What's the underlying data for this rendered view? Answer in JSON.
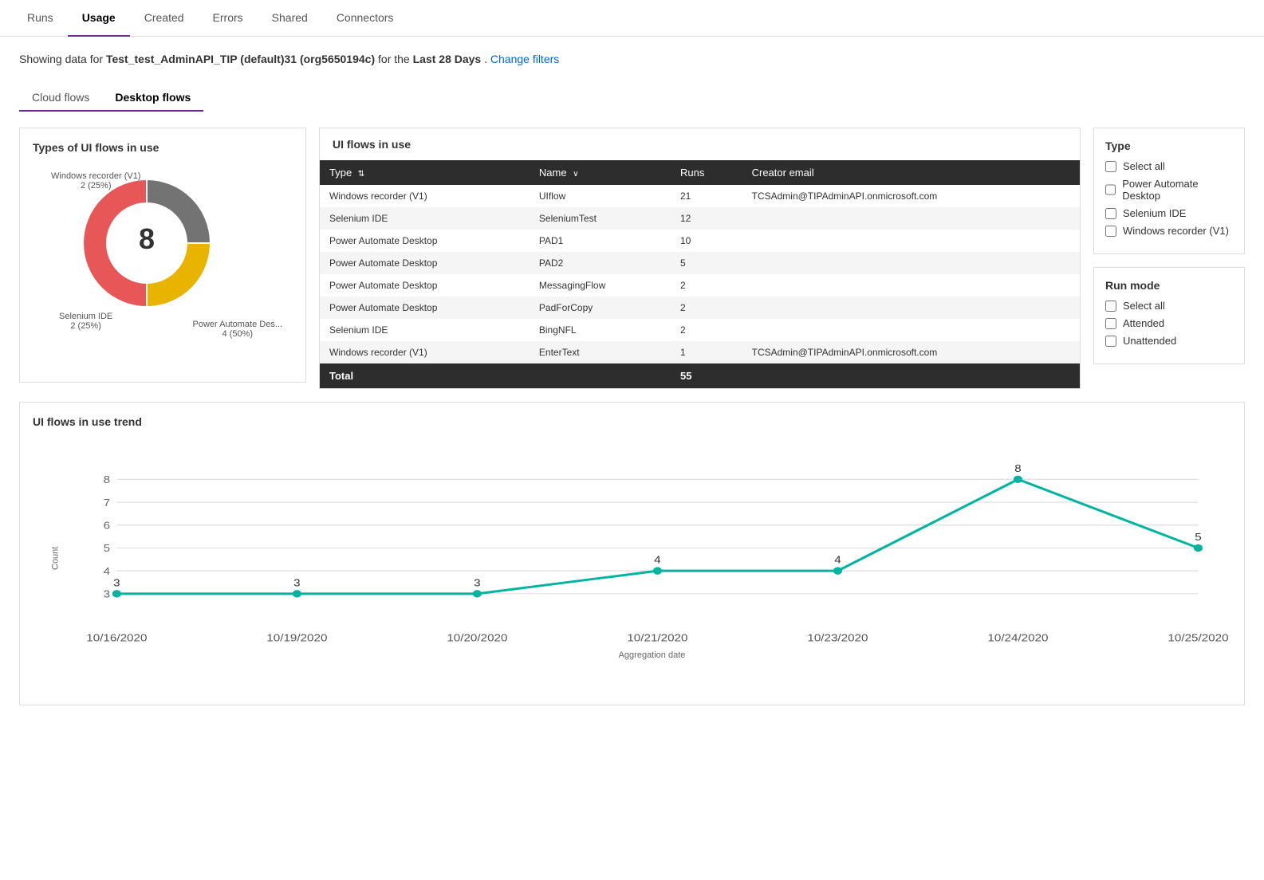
{
  "nav": {
    "tabs": [
      {
        "id": "runs",
        "label": "Runs",
        "active": false
      },
      {
        "id": "usage",
        "label": "Usage",
        "active": true
      },
      {
        "id": "created",
        "label": "Created",
        "active": false
      },
      {
        "id": "errors",
        "label": "Errors",
        "active": false
      },
      {
        "id": "shared",
        "label": "Shared",
        "active": false
      },
      {
        "id": "connectors",
        "label": "Connectors",
        "active": false
      }
    ]
  },
  "subtitle": {
    "prefix": "Showing data for ",
    "org": "Test_test_AdminAPI_TIP (default)31 (org5650194c)",
    "middle": " for the ",
    "period": "Last 28 Days",
    "suffix": ".",
    "change_filters": "Change filters"
  },
  "flow_tabs": [
    {
      "label": "Cloud flows",
      "active": false
    },
    {
      "label": "Desktop flows",
      "active": true
    }
  ],
  "donut": {
    "title": "Types of UI flows in use",
    "center": "8",
    "segments": [
      {
        "label": "Windows recorder (V1)",
        "value": 2,
        "percent": 25,
        "color": "#737373"
      },
      {
        "label": "Selenium IDE",
        "value": 2,
        "percent": 25,
        "color": "#e8b400"
      },
      {
        "label": "Power Automate Des...",
        "value": 4,
        "percent": 50,
        "color": "#e85757"
      }
    ]
  },
  "ui_flows_table": {
    "title": "UI flows in use",
    "headers": [
      "Type",
      "Name",
      "Runs",
      "Creator email"
    ],
    "rows": [
      {
        "type": "Windows recorder (V1)",
        "name": "UIflow",
        "runs": "21",
        "creator": "TCSAdmin@TIPAdminAPI.onmicrosoft.com"
      },
      {
        "type": "Selenium IDE",
        "name": "SeleniumTest",
        "runs": "12",
        "creator": ""
      },
      {
        "type": "Power Automate Desktop",
        "name": "PAD1",
        "runs": "10",
        "creator": ""
      },
      {
        "type": "Power Automate Desktop",
        "name": "PAD2",
        "runs": "5",
        "creator": ""
      },
      {
        "type": "Power Automate Desktop",
        "name": "MessagingFlow",
        "runs": "2",
        "creator": ""
      },
      {
        "type": "Power Automate Desktop",
        "name": "PadForCopy",
        "runs": "2",
        "creator": ""
      },
      {
        "type": "Selenium IDE",
        "name": "BingNFL",
        "runs": "2",
        "creator": ""
      },
      {
        "type": "Windows recorder (V1)",
        "name": "EnterText",
        "runs": "1",
        "creator": "TCSAdmin@TIPAdminAPI.onmicrosoft.com"
      }
    ],
    "total_label": "Total",
    "total_value": "55"
  },
  "type_filter": {
    "title": "Type",
    "options": [
      {
        "label": "Select all",
        "checked": false
      },
      {
        "label": "Power Automate Desktop",
        "checked": false
      },
      {
        "label": "Selenium IDE",
        "checked": false
      },
      {
        "label": "Windows recorder (V1)",
        "checked": false
      }
    ]
  },
  "run_mode_filter": {
    "title": "Run mode",
    "options": [
      {
        "label": "Select all",
        "checked": false
      },
      {
        "label": "Attended",
        "checked": false
      },
      {
        "label": "Unattended",
        "checked": false
      }
    ]
  },
  "trend": {
    "title": "UI flows in use trend",
    "y_label": "Count",
    "x_label": "Aggregation date",
    "y_max": 8,
    "y_min": 3,
    "points": [
      {
        "date": "10/16/2020",
        "value": 3
      },
      {
        "date": "10/19/2020",
        "value": 3
      },
      {
        "date": "10/20/2020",
        "value": 3
      },
      {
        "date": "10/21/2020",
        "value": 4
      },
      {
        "date": "10/23/2020",
        "value": 4
      },
      {
        "date": "10/24/2020",
        "value": 8
      },
      {
        "date": "10/25/2020",
        "value": 5
      }
    ]
  }
}
